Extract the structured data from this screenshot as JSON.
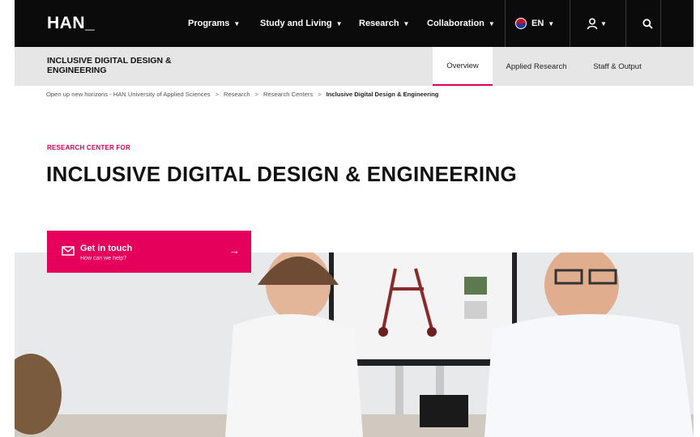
{
  "header": {
    "logo": "HAN_",
    "nav": [
      {
        "label": "Programs"
      },
      {
        "label": "Study and Living"
      },
      {
        "label": "Research"
      },
      {
        "label": "Collaboration"
      }
    ],
    "language": "EN",
    "chevron": "⌄"
  },
  "section": {
    "title": "INCLUSIVE DIGITAL DESIGN & ENGINEERING",
    "tabs": [
      {
        "label": "Overview",
        "active": true
      },
      {
        "label": "Applied Research",
        "active": false
      },
      {
        "label": "Staff & Output",
        "active": false
      }
    ]
  },
  "breadcrumb": [
    "Open up new horizons - HAN University of Applied Sciences",
    "Research",
    "Research Centers",
    "Inclusive Digital Design & Engineering"
  ],
  "hero": {
    "eyebrow": "RESEARCH CENTER FOR",
    "title": "INCLUSIVE DIGITAL DESIGN & ENGINEERING"
  },
  "cta": {
    "title": "Get in touch",
    "subtitle": "How can we help?",
    "arrow": "→"
  },
  "colors": {
    "accent": "#e2005a",
    "nav_bg": "#0b0b0b",
    "subbar_bg": "#e6e6e6"
  },
  "icons": [
    "mail-icon",
    "user-icon",
    "search-icon",
    "flag-icon",
    "arrow-right-icon",
    "chevron-down-icon"
  ]
}
